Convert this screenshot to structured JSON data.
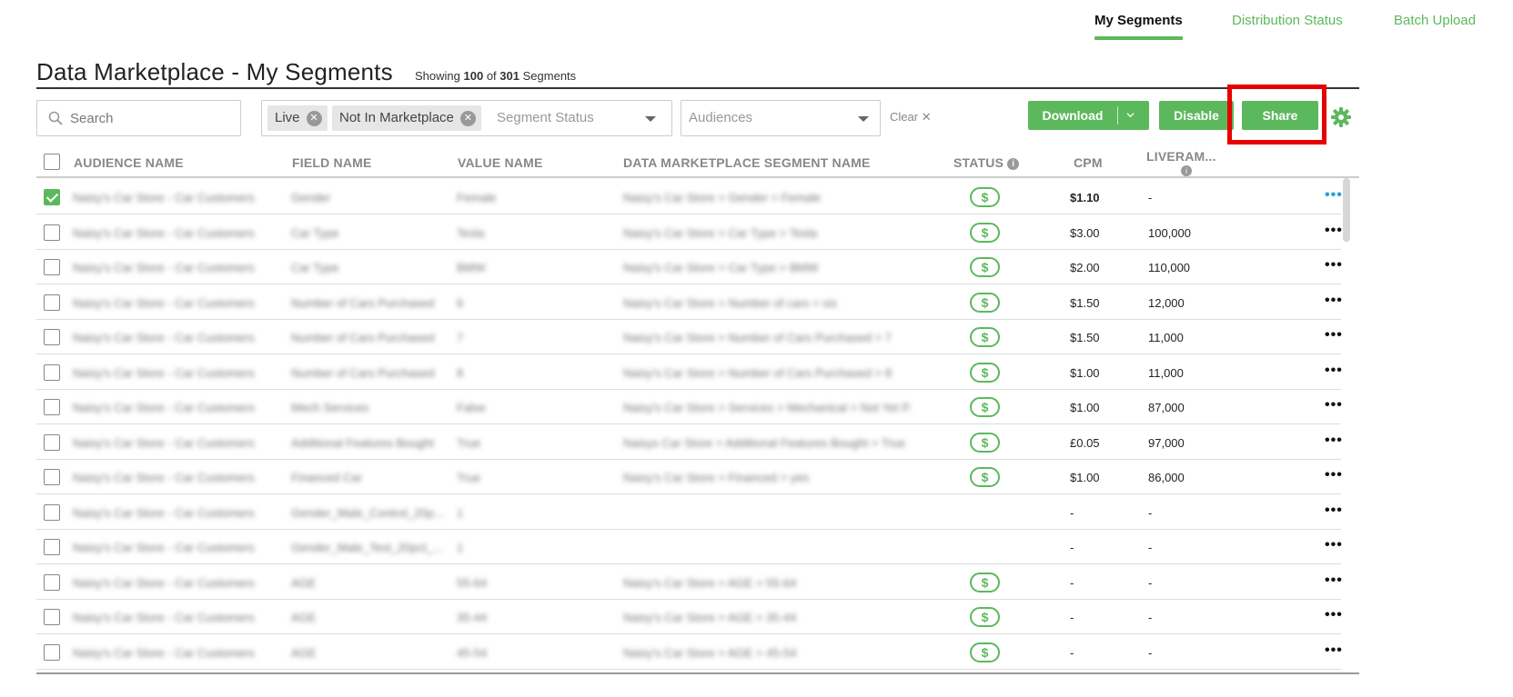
{
  "nav": {
    "tabs": [
      {
        "label": "My Segments",
        "active": true
      },
      {
        "label": "Distribution Status",
        "active": false
      },
      {
        "label": "Batch Upload",
        "active": false
      }
    ]
  },
  "header": {
    "title": "Data Marketplace - My Segments",
    "showing_prefix": "Showing",
    "showing_count": "100",
    "showing_of": "of",
    "showing_total": "301",
    "showing_suffix": "Segments"
  },
  "toolbar": {
    "search_placeholder": "Search",
    "status_chips": [
      "Live",
      "Not In Marketplace"
    ],
    "status_placeholder": "Segment Status",
    "audiences_placeholder": "Audiences",
    "clear_label": "Clear",
    "download_label": "Download",
    "disable_label": "Disable",
    "share_label": "Share"
  },
  "colors": {
    "accent": "#5cb85c",
    "highlight": "#e60000",
    "link_blue": "#2a9fd6"
  },
  "table": {
    "columns": {
      "audience": "AUDIENCE NAME",
      "field": "FIELD NAME",
      "value": "VALUE NAME",
      "segment": "DATA MARKETPLACE SEGMENT NAME",
      "status": "STATUS",
      "cpm": "CPM",
      "liveramp": "LIVERAM..."
    },
    "rows": [
      {
        "checked": true,
        "audience": "Naisy's Car Store - Car Customers",
        "field": "Gender",
        "value": "Female",
        "segment": "Naisy's Car Store > Gender > Female",
        "status": "$",
        "cpm": "$1.10",
        "liveramp": "-",
        "dots": "•••"
      },
      {
        "checked": false,
        "audience": "Naisy's Car Store - Car Customers",
        "field": "Car Type",
        "value": "Tesla",
        "segment": "Naisy's Car Store > Car Type > Tesla",
        "status": "$",
        "cpm": "$3.00",
        "liveramp": "100,000",
        "dots": "•••"
      },
      {
        "checked": false,
        "audience": "Naisy's Car Store - Car Customers",
        "field": "Car Type",
        "value": "BMW",
        "segment": "Naisy's Car Store > Car Type > BMW",
        "status": "$",
        "cpm": "$2.00",
        "liveramp": "110,000",
        "dots": "•••"
      },
      {
        "checked": false,
        "audience": "Naisy's Car Store - Car Customers",
        "field": "Number of Cars Purchased",
        "value": "6",
        "segment": "Naisy's Car Store > Number of cars > six",
        "status": "$",
        "cpm": "$1.50",
        "liveramp": "12,000",
        "dots": "•••"
      },
      {
        "checked": false,
        "audience": "Naisy's Car Store - Car Customers",
        "field": "Number of Cars Purchased",
        "value": "7",
        "segment": "Naisy's Car Store > Number of Cars Purchased > 7",
        "status": "$",
        "cpm": "$1.50",
        "liveramp": "11,000",
        "dots": "•••"
      },
      {
        "checked": false,
        "audience": "Naisy's Car Store - Car Customers",
        "field": "Number of Cars Purchased",
        "value": "8",
        "segment": "Naisy's Car Store > Number of Cars Purchased > 8",
        "status": "$",
        "cpm": "$1.00",
        "liveramp": "11,000",
        "dots": "•••"
      },
      {
        "checked": false,
        "audience": "Naisy's Car Store - Car Customers",
        "field": "Mech Services",
        "value": "False",
        "segment": "Naisy's Car Store > Services > Mechanical > Not Yet P...",
        "status": "$",
        "cpm": "$1.00",
        "liveramp": "87,000",
        "dots": "•••"
      },
      {
        "checked": false,
        "audience": "Naisy's Car Store - Car Customers",
        "field": "Additional Features Bought",
        "value": "True",
        "segment": "Naisys Car Store > Additional Features Bought > True",
        "status": "$",
        "cpm": "£0.05",
        "liveramp": "97,000",
        "dots": "•••"
      },
      {
        "checked": false,
        "audience": "Naisy's Car Store - Car Customers",
        "field": "Financed Car",
        "value": "True",
        "segment": "Naisy's Car Store > Financed > yes",
        "status": "$",
        "cpm": "$1.00",
        "liveramp": "86,000",
        "dots": "•••"
      },
      {
        "checked": false,
        "audience": "Naisy's Car Store - Car Customers",
        "field": "Gender_Male_Control_20p...",
        "value": "1",
        "segment": "",
        "status": "",
        "cpm": "-",
        "liveramp": "-",
        "dots": "•••"
      },
      {
        "checked": false,
        "audience": "Naisy's Car Store - Car Customers",
        "field": "Gender_Male_Test_20pct_...",
        "value": "1",
        "segment": "",
        "status": "",
        "cpm": "-",
        "liveramp": "-",
        "dots": "•••"
      },
      {
        "checked": false,
        "audience": "Naisy's Car Store - Car Customers",
        "field": "AGE",
        "value": "55-64",
        "segment": "Naisy's Car Store > AGE > 55-64",
        "status": "$",
        "cpm": "-",
        "liveramp": "-",
        "dots": "•••"
      },
      {
        "checked": false,
        "audience": "Naisy's Car Store - Car Customers",
        "field": "AGE",
        "value": "35-44",
        "segment": "Naisy's Car Store > AGE > 35-44",
        "status": "$",
        "cpm": "-",
        "liveramp": "-",
        "dots": "•••"
      },
      {
        "checked": false,
        "audience": "Naisy's Car Store - Car Customers",
        "field": "AGE",
        "value": "45-54",
        "segment": "Naisy's Car Store > AGE > 45-54",
        "status": "$",
        "cpm": "-",
        "liveramp": "-",
        "dots": "•••"
      }
    ]
  }
}
